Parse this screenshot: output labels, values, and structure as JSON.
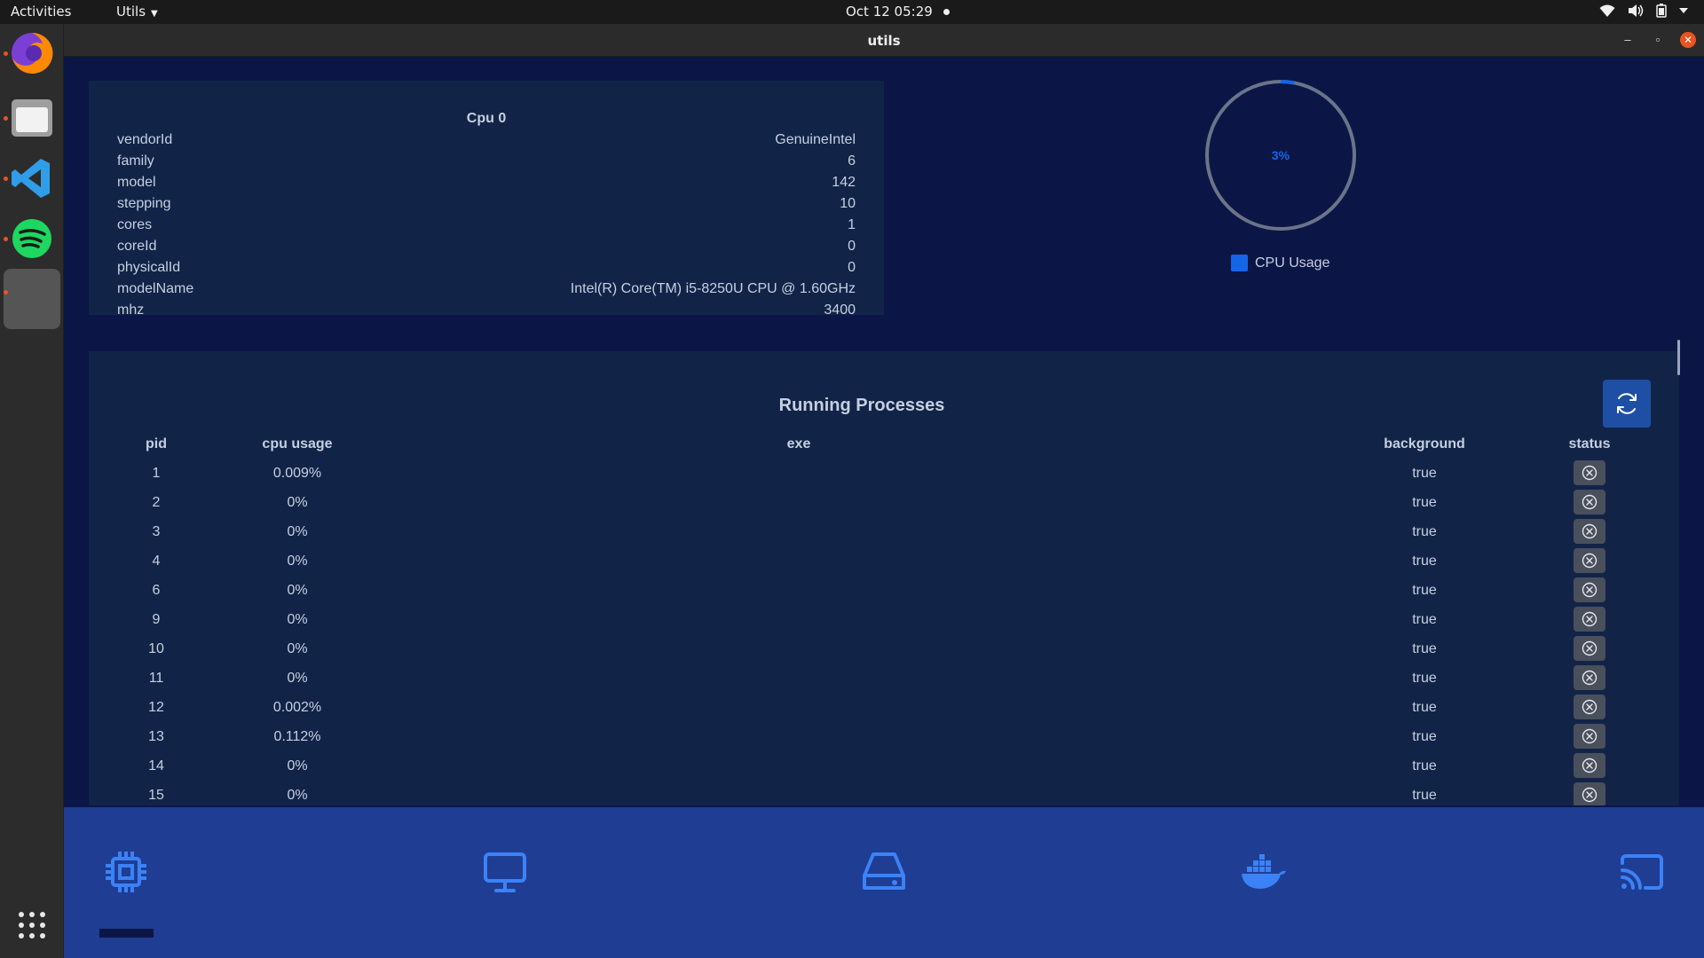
{
  "topbar": {
    "activities": "Activities",
    "app_menu": "Utils",
    "clock": "Oct 12  05:29"
  },
  "window": {
    "title": "utils",
    "minimize": "–",
    "maximize": "▫",
    "close": "✕"
  },
  "cpu": {
    "title": "Cpu 0",
    "rows": [
      {
        "key": "vendorId",
        "value": "GenuineIntel"
      },
      {
        "key": "family",
        "value": "6"
      },
      {
        "key": "model",
        "value": "142"
      },
      {
        "key": "stepping",
        "value": "10"
      },
      {
        "key": "cores",
        "value": "1"
      },
      {
        "key": "coreId",
        "value": "0"
      },
      {
        "key": "physicalId",
        "value": "0"
      },
      {
        "key": "modelName",
        "value": "Intel(R) Core(TM) i5-8250U CPU @ 1.60GHz"
      },
      {
        "key": "mhz",
        "value": "3400"
      }
    ]
  },
  "gauge": {
    "value_label": "3%",
    "value": 3,
    "legend": "CPU Usage",
    "color": "#1565e8"
  },
  "processes": {
    "title": "Running Processes",
    "columns": [
      "pid",
      "cpu usage",
      "exe",
      "background",
      "status"
    ],
    "rows": [
      {
        "pid": "1",
        "cpu": "0.009%",
        "exe": "",
        "background": "true"
      },
      {
        "pid": "2",
        "cpu": "0%",
        "exe": "",
        "background": "true"
      },
      {
        "pid": "3",
        "cpu": "0%",
        "exe": "",
        "background": "true"
      },
      {
        "pid": "4",
        "cpu": "0%",
        "exe": "",
        "background": "true"
      },
      {
        "pid": "6",
        "cpu": "0%",
        "exe": "",
        "background": "true"
      },
      {
        "pid": "9",
        "cpu": "0%",
        "exe": "",
        "background": "true"
      },
      {
        "pid": "10",
        "cpu": "0%",
        "exe": "",
        "background": "true"
      },
      {
        "pid": "11",
        "cpu": "0%",
        "exe": "",
        "background": "true"
      },
      {
        "pid": "12",
        "cpu": "0.002%",
        "exe": "",
        "background": "true"
      },
      {
        "pid": "13",
        "cpu": "0.112%",
        "exe": "",
        "background": "true"
      },
      {
        "pid": "14",
        "cpu": "0%",
        "exe": "",
        "background": "true"
      },
      {
        "pid": "15",
        "cpu": "0%",
        "exe": "",
        "background": "true"
      }
    ]
  },
  "bottom_nav": {
    "items": [
      "cpu-icon",
      "monitor-icon",
      "hard-drive-icon",
      "docker-icon",
      "cast-icon"
    ],
    "active_index": 0,
    "icon_color": "#3b82f6"
  },
  "colors": {
    "window_bg": "#0c1646",
    "card_bg": "#112448",
    "nav_bg": "#1f3d92",
    "accent": "#1565e8"
  }
}
